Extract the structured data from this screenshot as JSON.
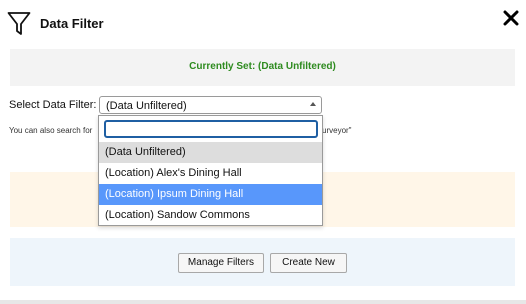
{
  "dialog": {
    "title": "Data Filter",
    "close_label": "×"
  },
  "status": {
    "text": "Currently Set: (Data Unfiltered)",
    "color": "#2e8b1f"
  },
  "filter_select": {
    "label": "Select Data Filter:",
    "value": "(Data Unfiltered)",
    "search_value": "",
    "options": [
      "(Data Unfiltered)",
      "(Location) Alex's Dining Hall",
      "(Location) Ipsum Dining Hall",
      "(Location) Sandow Commons"
    ],
    "highlighted_option": "(Location) Ipsum Dining Hall",
    "highlight_color": "#5897fb"
  },
  "search_note": {
    "prefix": "You can also search for",
    "suffix": "surveyor\""
  },
  "buttons": {
    "manage": "Manage Filters",
    "create": "Create New"
  },
  "icons": {
    "filter": "funnel-icon",
    "close": "close-icon",
    "select_arrow": "caret-up-icon"
  }
}
